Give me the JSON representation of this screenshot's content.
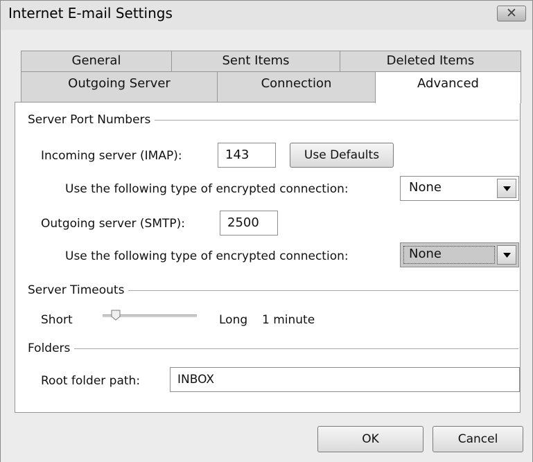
{
  "dialog": {
    "title": "Internet E-mail Settings",
    "close_glyph": "✕"
  },
  "tabs_row1": [
    "General",
    "Sent Items",
    "Deleted Items"
  ],
  "tabs_row2": [
    "Outgoing Server",
    "Connection",
    "Advanced"
  ],
  "active_tab": "Advanced",
  "server_ports": {
    "heading": "Server Port Numbers",
    "incoming_label": "Incoming server (IMAP):",
    "incoming_value": "143",
    "use_defaults_label": "Use Defaults",
    "encrypt_label_1": "Use the following type of encrypted connection:",
    "encrypt_value_1": "None",
    "outgoing_label": "Outgoing server (SMTP):",
    "outgoing_value": "2500",
    "encrypt_label_2": "Use the following type of encrypted connection:",
    "encrypt_value_2": "None"
  },
  "timeouts": {
    "heading": "Server Timeouts",
    "short_label": "Short",
    "long_label": "Long",
    "value_label": "1 minute",
    "slider_fraction": 0.1
  },
  "folders": {
    "heading": "Folders",
    "root_label": "Root folder path:",
    "root_value": "INBOX"
  },
  "buttons": {
    "ok": "OK",
    "cancel": "Cancel"
  },
  "icons": {
    "close": "close-icon",
    "dropdown": "chevron-down-icon",
    "slider": "slider-thumb-icon"
  }
}
